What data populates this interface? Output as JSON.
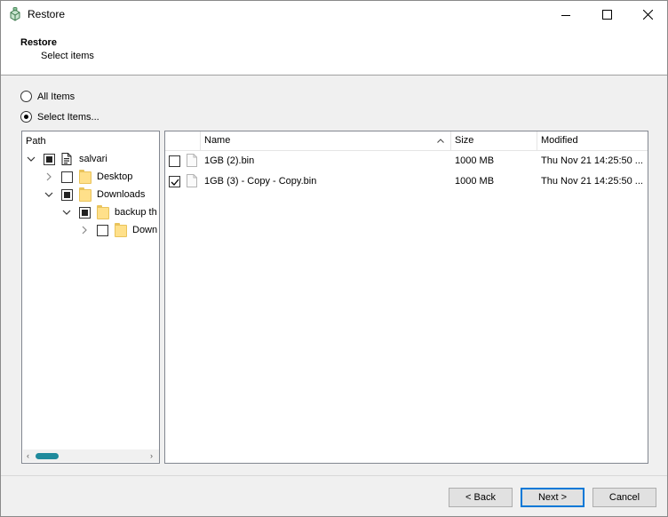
{
  "window": {
    "title": "Restore"
  },
  "header": {
    "title": "Restore",
    "subtitle": "Select items"
  },
  "options": {
    "all_items": {
      "label": "All Items",
      "selected": false
    },
    "select_items": {
      "label": "Select Items...",
      "selected": true
    }
  },
  "tree": {
    "header": "Path",
    "nodes": [
      {
        "label": "salvari",
        "expanded": true,
        "check": "partial",
        "icon": "document-icon"
      },
      {
        "label": "Desktop",
        "expanded": false,
        "check": "unchecked",
        "icon": "folder-icon"
      },
      {
        "label": "Downloads",
        "expanded": true,
        "check": "partial",
        "icon": "folder-icon"
      },
      {
        "label": "backup th",
        "expanded": true,
        "check": "partial",
        "icon": "folder-icon"
      },
      {
        "label": "Down",
        "expanded": false,
        "check": "unchecked",
        "icon": "folder-icon"
      }
    ],
    "scroll": {
      "left": "‹",
      "right": "›"
    }
  },
  "list": {
    "columns": {
      "name": "Name",
      "size": "Size",
      "modified": "Modified"
    },
    "sort": {
      "column": "Name",
      "direction": "ascending"
    },
    "rows": [
      {
        "checked": false,
        "name": "1GB (2).bin",
        "size": "1000 MB",
        "modified": "Thu Nov 21 14:25:50 ..."
      },
      {
        "checked": true,
        "name": "1GB (3) - Copy - Copy.bin",
        "size": "1000 MB",
        "modified": "Thu Nov 21 14:25:50 ..."
      }
    ]
  },
  "buttons": {
    "back": "< Back",
    "next": "Next >",
    "cancel": "Cancel"
  },
  "colors": {
    "accent": "#0078d7",
    "scroll_thumb": "#1f8a9c",
    "folder": "#ffe08a"
  }
}
